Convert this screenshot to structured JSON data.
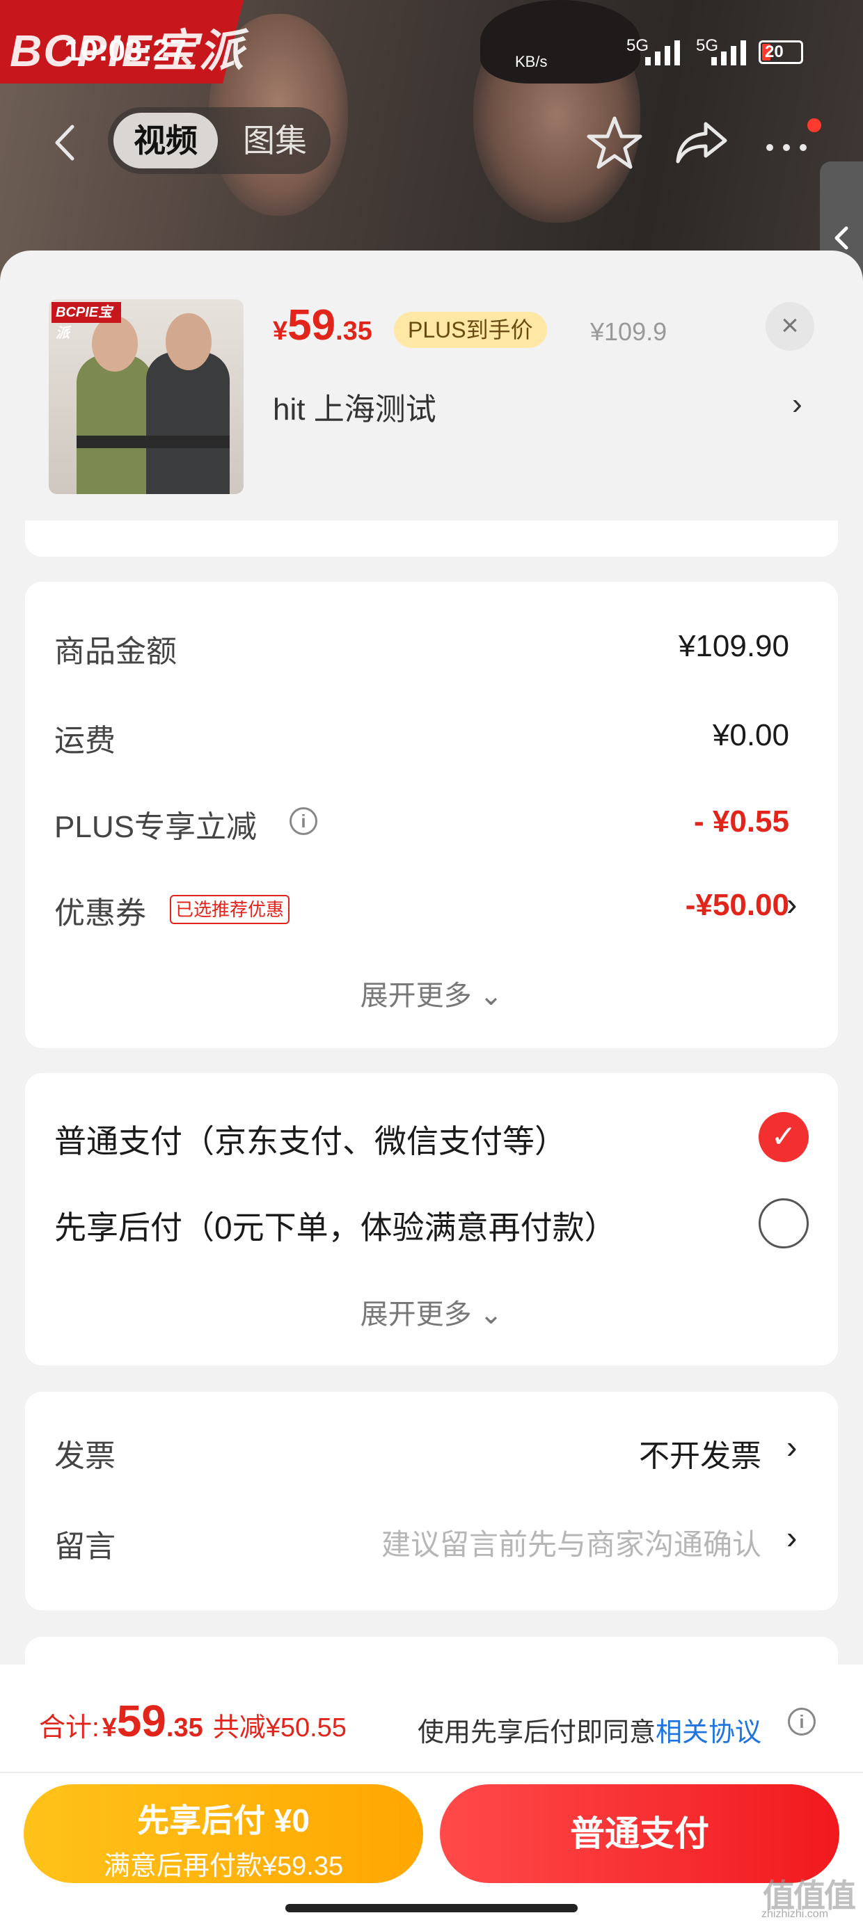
{
  "status_bar": {
    "time": "10:03:27",
    "net_speed": "KB/s",
    "signal_1": "5G",
    "signal_2": "5G",
    "battery": "20",
    "battery_level": 0.2
  },
  "hero": {
    "brand_logo": "BCPIE宝派",
    "tabs": [
      {
        "label": "视频",
        "active": true
      },
      {
        "label": "图集",
        "active": false
      }
    ]
  },
  "product": {
    "brand_tag": "BCPIE宝派",
    "price_currency": "¥",
    "price_int": "59",
    "price_dec": ".35",
    "plus_tag": "PLUS到手价",
    "original_price": "¥109.9",
    "address": "hit  上海测试",
    "close_label": "×"
  },
  "summary": {
    "rows": [
      {
        "label": "商品金额",
        "value": "¥109.90"
      },
      {
        "label": "运费",
        "value": "¥0.00"
      },
      {
        "label": "PLUS专享立减",
        "value": "- ¥0.55"
      },
      {
        "label": "优惠券",
        "value": "-¥50.00",
        "tag": "已选推荐优惠"
      }
    ],
    "expand_label": "展开更多"
  },
  "payment": {
    "options": [
      {
        "label": "普通支付（京东支付、微信支付等）",
        "selected": true
      },
      {
        "label": "先享后付（0元下单，体验满意再付款）",
        "selected": false
      }
    ],
    "expand_label": "展开更多"
  },
  "extras": {
    "invoice_label": "发票",
    "invoice_value": "不开发票",
    "note_label": "留言",
    "note_placeholder": "建议留言前先与商家沟通确认"
  },
  "footer": {
    "total_label": "合计:",
    "total_currency": "¥",
    "total_int": "59",
    "total_dec": ".35",
    "saving": "共减¥50.55",
    "agree_text": "使用先享后付即同意",
    "agree_link": "相关协议",
    "bnpl_line1": "先享后付 ¥0",
    "bnpl_line2": "满意后再付款¥59.35",
    "normal_pay": "普通支付"
  },
  "watermark": {
    "mark": "值值值",
    "site": "zhizhizhi.com"
  },
  "colors": {
    "accent_red": "#e1251b",
    "bnpl_yellow": "#ffb300",
    "link_blue": "#1f74e0",
    "plus_gold": "#ffe8a6"
  }
}
